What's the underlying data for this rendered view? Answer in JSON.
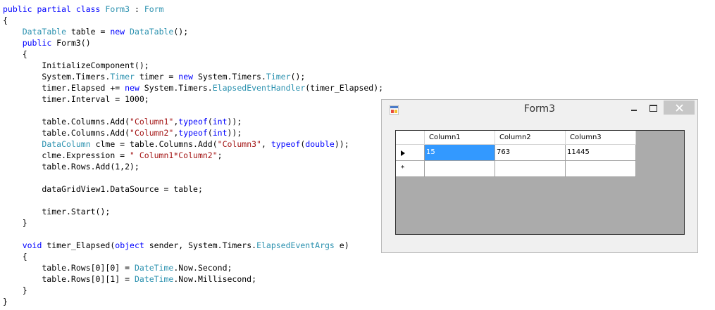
{
  "code": [
    [
      {
        "t": "public partial class ",
        "c": "kw"
      },
      {
        "t": "Form3",
        "c": "ty"
      },
      {
        "t": " : ",
        "c": ""
      },
      {
        "t": "Form",
        "c": "ty"
      }
    ],
    [
      {
        "t": "{",
        "c": ""
      }
    ],
    [
      {
        "t": "    ",
        "c": ""
      },
      {
        "t": "DataTable",
        "c": "ty"
      },
      {
        "t": " table = ",
        "c": ""
      },
      {
        "t": "new",
        "c": "kw"
      },
      {
        "t": " ",
        "c": ""
      },
      {
        "t": "DataTable",
        "c": "ty"
      },
      {
        "t": "();",
        "c": ""
      }
    ],
    [
      {
        "t": "    ",
        "c": ""
      },
      {
        "t": "public",
        "c": "kw"
      },
      {
        "t": " Form3()",
        "c": ""
      }
    ],
    [
      {
        "t": "    {",
        "c": ""
      }
    ],
    [
      {
        "t": "        InitializeComponent();",
        "c": ""
      }
    ],
    [
      {
        "t": "        System.Timers.",
        "c": ""
      },
      {
        "t": "Timer",
        "c": "ty"
      },
      {
        "t": " timer = ",
        "c": ""
      },
      {
        "t": "new",
        "c": "kw"
      },
      {
        "t": " System.Timers.",
        "c": ""
      },
      {
        "t": "Timer",
        "c": "ty"
      },
      {
        "t": "();",
        "c": ""
      }
    ],
    [
      {
        "t": "        timer.Elapsed += ",
        "c": ""
      },
      {
        "t": "new",
        "c": "kw"
      },
      {
        "t": " System.Timers.",
        "c": ""
      },
      {
        "t": "ElapsedEventHandler",
        "c": "ty"
      },
      {
        "t": "(timer_Elapsed);",
        "c": ""
      }
    ],
    [
      {
        "t": "        timer.Interval = 1000;",
        "c": ""
      }
    ],
    [],
    [
      {
        "t": "        table.Columns.Add(",
        "c": ""
      },
      {
        "t": "\"Column1\"",
        "c": "st"
      },
      {
        "t": ",",
        "c": ""
      },
      {
        "t": "typeof",
        "c": "kw"
      },
      {
        "t": "(",
        "c": ""
      },
      {
        "t": "int",
        "c": "kw"
      },
      {
        "t": "));",
        "c": ""
      }
    ],
    [
      {
        "t": "        table.Columns.Add(",
        "c": ""
      },
      {
        "t": "\"Column2\"",
        "c": "st"
      },
      {
        "t": ",",
        "c": ""
      },
      {
        "t": "typeof",
        "c": "kw"
      },
      {
        "t": "(",
        "c": ""
      },
      {
        "t": "int",
        "c": "kw"
      },
      {
        "t": "));",
        "c": ""
      }
    ],
    [
      {
        "t": "        ",
        "c": ""
      },
      {
        "t": "DataColumn",
        "c": "ty"
      },
      {
        "t": " clme = table.Columns.Add(",
        "c": ""
      },
      {
        "t": "\"Column3\"",
        "c": "st"
      },
      {
        "t": ", ",
        "c": ""
      },
      {
        "t": "typeof",
        "c": "kw"
      },
      {
        "t": "(",
        "c": ""
      },
      {
        "t": "double",
        "c": "kw"
      },
      {
        "t": "));",
        "c": ""
      }
    ],
    [
      {
        "t": "        clme.Expression = ",
        "c": ""
      },
      {
        "t": "\" Column1*Column2\"",
        "c": "st"
      },
      {
        "t": ";",
        "c": ""
      }
    ],
    [
      {
        "t": "        table.Rows.Add(1,2);",
        "c": ""
      }
    ],
    [],
    [
      {
        "t": "        dataGridView1.DataSource = table;",
        "c": ""
      }
    ],
    [],
    [
      {
        "t": "        timer.Start();",
        "c": ""
      }
    ],
    [
      {
        "t": "    }",
        "c": ""
      }
    ],
    [],
    [
      {
        "t": "    ",
        "c": ""
      },
      {
        "t": "void",
        "c": "kw"
      },
      {
        "t": " timer_Elapsed(",
        "c": ""
      },
      {
        "t": "object",
        "c": "kw"
      },
      {
        "t": " sender, System.Timers.",
        "c": ""
      },
      {
        "t": "ElapsedEventArgs",
        "c": "ty"
      },
      {
        "t": " e)",
        "c": ""
      }
    ],
    [
      {
        "t": "    {",
        "c": ""
      }
    ],
    [
      {
        "t": "        table.Rows[0][0] = ",
        "c": ""
      },
      {
        "t": "DateTime",
        "c": "ty"
      },
      {
        "t": ".Now.Second;",
        "c": ""
      }
    ],
    [
      {
        "t": "        table.Rows[0][1] = ",
        "c": ""
      },
      {
        "t": "DateTime",
        "c": "ty"
      },
      {
        "t": ".Now.Millisecond;",
        "c": ""
      }
    ],
    [
      {
        "t": "    }",
        "c": ""
      }
    ],
    [
      {
        "t": "}",
        "c": ""
      }
    ]
  ],
  "window": {
    "title": "Form3",
    "grid": {
      "columns": [
        "Column1",
        "Column2",
        "Column3"
      ],
      "rows": [
        [
          "15",
          "763",
          "11445"
        ],
        [
          "",
          "",
          ""
        ]
      ],
      "new_row_marker": "*"
    }
  }
}
